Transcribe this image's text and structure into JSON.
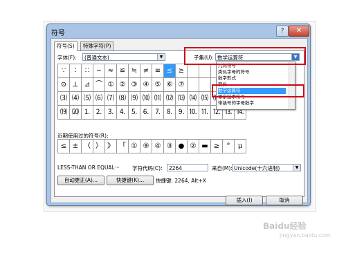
{
  "dialog": {
    "title": "符号",
    "help_label": "?",
    "close_label": "✕"
  },
  "tabs": [
    {
      "label": "符号(S)"
    },
    {
      "label": "特殊字符(P)"
    }
  ],
  "font": {
    "label": "字体(F):",
    "value": "(普通文本)"
  },
  "subset": {
    "label": "子集(U):",
    "value": "数学运算符"
  },
  "subset_dropdown": {
    "items": [
      "几何符号",
      "类似字母的符号",
      "数字形式",
      "箭头",
      "数学运算符",
      "零杂技术符号",
      "带括号的字母数字"
    ],
    "selected_index": 4
  },
  "symbol_grid": {
    "rows": [
      [
        "∵",
        "∶",
        "∷",
        "∽",
        "≈",
        "≌",
        "≒",
        "≠",
        "≡",
        "≤",
        "≥",
        "",
        "",
        "",
        "",
        ""
      ],
      [
        "⊙",
        "⊥",
        "⊿",
        "⌒",
        "①",
        "②",
        "③",
        "④",
        "⑤",
        "⑥",
        "⑦",
        "",
        "",
        "",
        "",
        ""
      ],
      [
        "⑶",
        "⑷",
        "⑸",
        "⑹",
        "⑺",
        "⑻",
        "⑼",
        "⑽",
        "⑾",
        "⑿",
        "⒀",
        "⒁",
        "⒂",
        "⒃",
        "⒄",
        "⒅"
      ],
      [
        "⒆",
        "⒇",
        "⒈",
        "⒉",
        "⒊",
        "⒋",
        "⒌",
        "⒍",
        "⒎",
        "⒏",
        "⒐",
        "⒑",
        "⒒",
        "⒓",
        "⒔",
        "⒕"
      ]
    ],
    "selected": [
      0,
      9
    ]
  },
  "recent": {
    "label": "近期使用过的符号(R):",
    "symbols": [
      "≤",
      "±",
      "〈",
      "〉",
      "》",
      "「",
      "①",
      "⑨",
      "④",
      "③",
      "●",
      "②",
      "▬",
      "≥",
      "°",
      "μ"
    ]
  },
  "char_info": {
    "name": "LESS-THAN OR EQUAL···",
    "code_label": "字符代码(C):",
    "code_value": "2264",
    "from_label": "来自(M):",
    "from_value": "Unicode(十六进制)"
  },
  "buttons": {
    "autocorrect": "自动更正(A)...",
    "shortcut_key": "快捷键(K)...",
    "shortcut_text": "快捷键: 2264, Alt+X",
    "insert": "插入(I)",
    "cancel": "取消"
  },
  "watermark": {
    "text": "Baidu经验",
    "sub": "jingyan.baidu.com"
  },
  "colors": {
    "selection": "#3399ff",
    "highlight_box": "#d0021b",
    "title_bar": "#a9c4e4"
  }
}
